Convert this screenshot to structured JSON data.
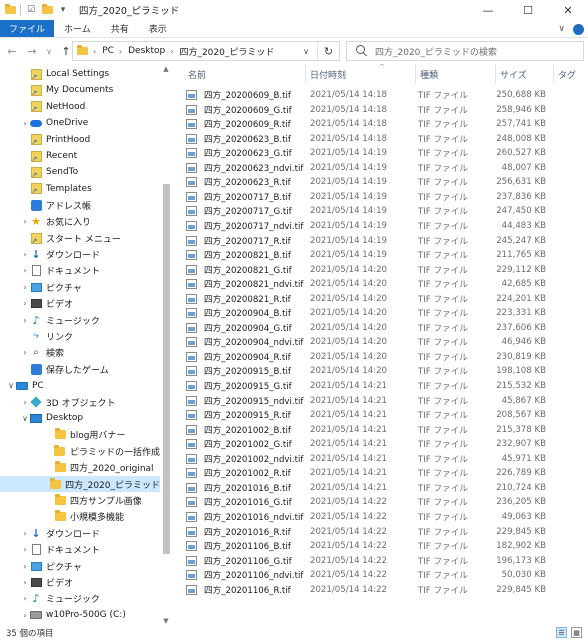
{
  "window": {
    "title": "四方_2020_ピラミッド",
    "controls": {
      "minimize": "—",
      "maximize": "☐",
      "close": "✕"
    }
  },
  "quick_access": {
    "pin": "☑",
    "dropdown": "▾"
  },
  "ribbon": {
    "tabs": [
      {
        "label": "ファイル"
      },
      {
        "label": "ホーム"
      },
      {
        "label": "共有"
      },
      {
        "label": "表示"
      }
    ],
    "expand": "∨",
    "help": "?"
  },
  "nav": {
    "back": "←",
    "forward": "→",
    "recent": "∨",
    "up": "↑",
    "breadcrumb": [
      "PC",
      "Desktop",
      "四方_2020_ピラミッド"
    ],
    "crumb_sep": "›",
    "dropdown": "∨",
    "refresh": "↻",
    "search_placeholder": "四方_2020_ピラミッドの検索"
  },
  "sidebar": {
    "items": [
      {
        "label": "Local Settings",
        "icon": "shortcut-icon",
        "chevron": ""
      },
      {
        "label": "My Documents",
        "icon": "shortcut-icon",
        "chevron": ""
      },
      {
        "label": "NetHood",
        "icon": "shortcut-icon",
        "chevron": ""
      },
      {
        "label": "OneDrive",
        "icon": "cloud-icon",
        "chevron": "›"
      },
      {
        "label": "PrintHood",
        "icon": "shortcut-icon",
        "chevron": ""
      },
      {
        "label": "Recent",
        "icon": "shortcut-icon",
        "chevron": ""
      },
      {
        "label": "SendTo",
        "icon": "shortcut-icon",
        "chevron": ""
      },
      {
        "label": "Templates",
        "icon": "shortcut-icon",
        "chevron": ""
      },
      {
        "label": "アドレス帳",
        "icon": "contacts-icon",
        "chevron": ""
      },
      {
        "label": "お気に入り",
        "icon": "star-icon",
        "chevron": "›"
      },
      {
        "label": "スタート メニュー",
        "icon": "shortcut-icon",
        "chevron": ""
      },
      {
        "label": "ダウンロード",
        "icon": "download-icon",
        "chevron": "›"
      },
      {
        "label": "ドキュメント",
        "icon": "document-icon",
        "chevron": "›"
      },
      {
        "label": "ピクチャ",
        "icon": "picture-icon",
        "chevron": "›"
      },
      {
        "label": "ビデオ",
        "icon": "video-icon",
        "chevron": "›"
      },
      {
        "label": "ミュージック",
        "icon": "music-icon",
        "chevron": "›"
      },
      {
        "label": "リンク",
        "icon": "link-icon",
        "chevron": ""
      },
      {
        "label": "検索",
        "icon": "search-icon",
        "chevron": "›"
      },
      {
        "label": "保存したゲーム",
        "icon": "game-icon",
        "chevron": ""
      },
      {
        "label": "PC",
        "icon": "pc-icon",
        "chevron": "∨"
      },
      {
        "label": "3D オブジェクト",
        "icon": "3d-objects-icon",
        "chevron": "›"
      },
      {
        "label": "Desktop",
        "icon": "desktop-icon",
        "chevron": "∨"
      },
      {
        "label": "blog用バナー",
        "icon": "folder-icon",
        "chevron": ""
      },
      {
        "label": "ピラミッドの一括作成",
        "icon": "folder-icon",
        "chevron": ""
      },
      {
        "label": "四方_2020_original",
        "icon": "folder-icon",
        "chevron": ""
      },
      {
        "label": "四方_2020_ピラミッド",
        "icon": "folder-icon",
        "chevron": "",
        "selected": true
      },
      {
        "label": "四方サンプル画像",
        "icon": "folder-icon",
        "chevron": ""
      },
      {
        "label": "小規模多機能",
        "icon": "folder-icon",
        "chevron": ""
      },
      {
        "label": "ダウンロード",
        "icon": "download-icon",
        "chevron": "›"
      },
      {
        "label": "ドキュメント",
        "icon": "document-icon",
        "chevron": "›"
      },
      {
        "label": "ピクチャ",
        "icon": "picture-icon",
        "chevron": "›"
      },
      {
        "label": "ビデオ",
        "icon": "video-icon",
        "chevron": "›"
      },
      {
        "label": "ミュージック",
        "icon": "music-icon",
        "chevron": "›"
      },
      {
        "label": "w10Pro-500G (C:)",
        "icon": "drive-icon",
        "chevron": "›"
      }
    ]
  },
  "columns": {
    "name": "名前",
    "date": "日付時刻",
    "type": "種類",
    "size": "サイズ",
    "tag": "タグ"
  },
  "files": [
    {
      "name": "四方_20200609_B.tif",
      "date": "2021/05/14 14:18",
      "type": "TIF ファイル",
      "size": "250,688 KB"
    },
    {
      "name": "四方_20200609_G.tif",
      "date": "2021/05/14 14:18",
      "type": "TIF ファイル",
      "size": "258,946 KB"
    },
    {
      "name": "四方_20200609_R.tif",
      "date": "2021/05/14 14:18",
      "type": "TIF ファイル",
      "size": "257,741 KB"
    },
    {
      "name": "四方_20200623_B.tif",
      "date": "2021/05/14 14:18",
      "type": "TIF ファイル",
      "size": "248,008 KB"
    },
    {
      "name": "四方_20200623_G.tif",
      "date": "2021/05/14 14:19",
      "type": "TIF ファイル",
      "size": "260,527 KB"
    },
    {
      "name": "四方_20200623_ndvi.tif",
      "date": "2021/05/14 14:19",
      "type": "TIF ファイル",
      "size": "48,007 KB"
    },
    {
      "name": "四方_20200623_R.tif",
      "date": "2021/05/14 14:19",
      "type": "TIF ファイル",
      "size": "256,631 KB"
    },
    {
      "name": "四方_20200717_B.tif",
      "date": "2021/05/14 14:19",
      "type": "TIF ファイル",
      "size": "237,836 KB"
    },
    {
      "name": "四方_20200717_G.tif",
      "date": "2021/05/14 14:19",
      "type": "TIF ファイル",
      "size": "247,450 KB"
    },
    {
      "name": "四方_20200717_ndvi.tif",
      "date": "2021/05/14 14:19",
      "type": "TIF ファイル",
      "size": "44,483 KB"
    },
    {
      "name": "四方_20200717_R.tif",
      "date": "2021/05/14 14:19",
      "type": "TIF ファイル",
      "size": "245,247 KB"
    },
    {
      "name": "四方_20200821_B.tif",
      "date": "2021/05/14 14:19",
      "type": "TIF ファイル",
      "size": "211,765 KB"
    },
    {
      "name": "四方_20200821_G.tif",
      "date": "2021/05/14 14:20",
      "type": "TIF ファイル",
      "size": "229,112 KB"
    },
    {
      "name": "四方_20200821_ndvi.tif",
      "date": "2021/05/14 14:20",
      "type": "TIF ファイル",
      "size": "42,685 KB"
    },
    {
      "name": "四方_20200821_R.tif",
      "date": "2021/05/14 14:20",
      "type": "TIF ファイル",
      "size": "224,201 KB"
    },
    {
      "name": "四方_20200904_B.tif",
      "date": "2021/05/14 14:20",
      "type": "TIF ファイル",
      "size": "223,331 KB"
    },
    {
      "name": "四方_20200904_G.tif",
      "date": "2021/05/14 14:20",
      "type": "TIF ファイル",
      "size": "237,606 KB"
    },
    {
      "name": "四方_20200904_ndvi.tif",
      "date": "2021/05/14 14:20",
      "type": "TIF ファイル",
      "size": "46,946 KB"
    },
    {
      "name": "四方_20200904_R.tif",
      "date": "2021/05/14 14:20",
      "type": "TIF ファイル",
      "size": "230,819 KB"
    },
    {
      "name": "四方_20200915_B.tif",
      "date": "2021/05/14 14:20",
      "type": "TIF ファイル",
      "size": "198,108 KB"
    },
    {
      "name": "四方_20200915_G.tif",
      "date": "2021/05/14 14:21",
      "type": "TIF ファイル",
      "size": "215,532 KB"
    },
    {
      "name": "四方_20200915_ndvi.tif",
      "date": "2021/05/14 14:21",
      "type": "TIF ファイル",
      "size": "45,867 KB"
    },
    {
      "name": "四方_20200915_R.tif",
      "date": "2021/05/14 14:21",
      "type": "TIF ファイル",
      "size": "208,567 KB"
    },
    {
      "name": "四方_20201002_B.tif",
      "date": "2021/05/14 14:21",
      "type": "TIF ファイル",
      "size": "215,378 KB"
    },
    {
      "name": "四方_20201002_G.tif",
      "date": "2021/05/14 14:21",
      "type": "TIF ファイル",
      "size": "232,907 KB"
    },
    {
      "name": "四方_20201002_ndvi.tif",
      "date": "2021/05/14 14:21",
      "type": "TIF ファイル",
      "size": "45,971 KB"
    },
    {
      "name": "四方_20201002_R.tif",
      "date": "2021/05/14 14:21",
      "type": "TIF ファイル",
      "size": "226,789 KB"
    },
    {
      "name": "四方_20201016_B.tif",
      "date": "2021/05/14 14:21",
      "type": "TIF ファイル",
      "size": "210,724 KB"
    },
    {
      "name": "四方_20201016_G.tif",
      "date": "2021/05/14 14:22",
      "type": "TIF ファイル",
      "size": "236,205 KB"
    },
    {
      "name": "四方_20201016_ndvi.tif",
      "date": "2021/05/14 14:22",
      "type": "TIF ファイル",
      "size": "49,063 KB"
    },
    {
      "name": "四方_20201016_R.tif",
      "date": "2021/05/14 14:22",
      "type": "TIF ファイル",
      "size": "229,845 KB"
    },
    {
      "name": "四方_20201106_B.tif",
      "date": "2021/05/14 14:22",
      "type": "TIF ファイル",
      "size": "182,902 KB"
    },
    {
      "name": "四方_20201106_G.tif",
      "date": "2021/05/14 14:22",
      "type": "TIF ファイル",
      "size": "196,173 KB"
    },
    {
      "name": "四方_20201106_ndvi.tif",
      "date": "2021/05/14 14:22",
      "type": "TIF ファイル",
      "size": "50,030 KB"
    },
    {
      "name": "四方_20201106_R.tif",
      "date": "2021/05/14 14:22",
      "type": "TIF ファイル",
      "size": "229,845 KB"
    }
  ],
  "status": {
    "count": "35 個の項目",
    "view_details": "☰",
    "view_icons": "▦"
  },
  "colors": {
    "accent": "#1a6fc9",
    "selected": "#cce8ff",
    "folder": "#f5c542"
  }
}
